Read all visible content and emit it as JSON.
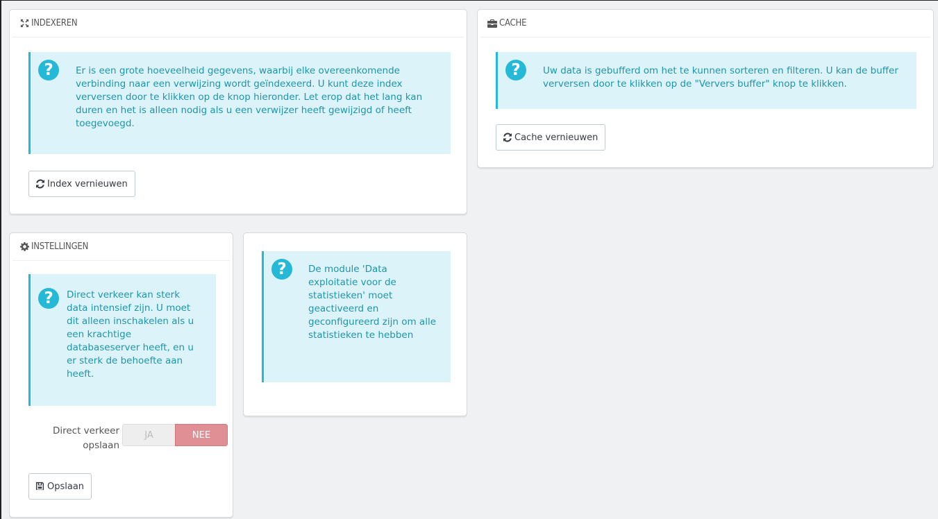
{
  "indexeren": {
    "title": "INDEXEREN",
    "icon": "expand-arrows-icon",
    "alert_text": "Er is een grote hoeveelheid gegevens, waarbij elke overeenkomende verbinding naar een verwijzing wordt geïndexeerd. U kunt deze index verversen door te klikken op de knop hieronder. Let erop dat het lang kan duren en het is alleen nodig als u een verwijzer heeft gewijzigd of heeft toegevoegd.",
    "button_label": "Index vernieuwen"
  },
  "cache": {
    "title": "CACHE",
    "icon": "briefcase-icon",
    "alert_text": "Uw data is gebufferd om het te kunnen sorteren en filteren. U kan de buffer verversen door te klikken op de \"Ververs buffer\" knop te klikken.",
    "button_label": "Cache vernieuwen"
  },
  "instellingen": {
    "title": "INSTELLINGEN",
    "icon": "gear-icon",
    "alert_text": "Direct verkeer kan sterk data intensief zijn. U moet dit alleen inschakelen als u een krachtige databaseserver heeft, en u er sterk de behoefte aan heeft.",
    "field_label": "Direct verkeer opslaan",
    "switch_yes": "JA",
    "switch_no": "NEE",
    "switch_value": "NEE",
    "save_label": "Opslaan"
  },
  "module_notice": {
    "alert_text": "De module 'Data exploitatie voor de statistieken' moet geactiveerd en geconfigureerd zijn om alle statistieken te hebben"
  },
  "colors": {
    "alert_bg": "#dcf4f9",
    "alert_border": "#25b9d7",
    "alert_text": "#1e94ab",
    "switch_no_active": "#e08f95"
  }
}
